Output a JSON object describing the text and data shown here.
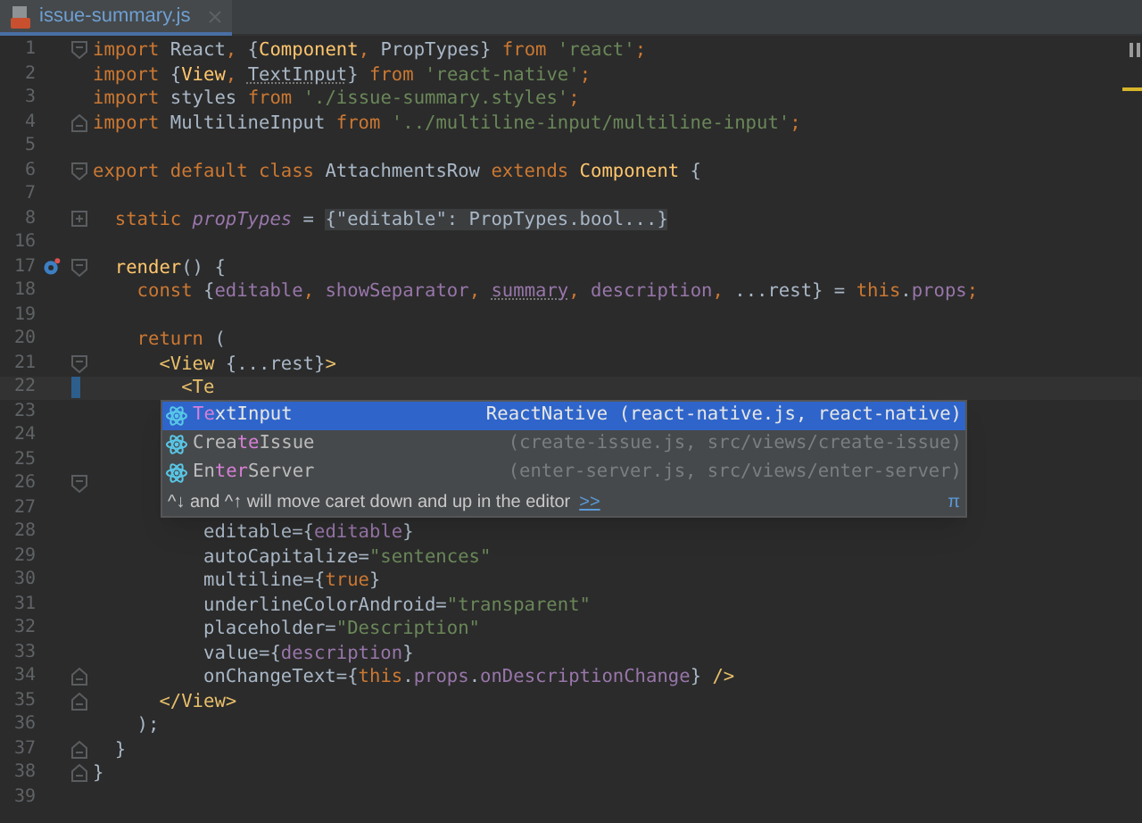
{
  "tab": {
    "title": "issue-summary.js",
    "selected": true
  },
  "lines": [
    {
      "number": "1",
      "fold": {
        "kind": "open"
      },
      "current": false,
      "tokens": [
        {
          "kind": "kw",
          "text": "import"
        },
        {
          "kind": "plain",
          "text": " React"
        },
        {
          "kind": "kw",
          "text": ","
        },
        {
          "kind": "plain",
          "text": " {"
        },
        {
          "kind": "type",
          "text": "Component"
        },
        {
          "kind": "kw",
          "text": ","
        },
        {
          "kind": "plain",
          "text": " PropTypes} "
        },
        {
          "kind": "kw",
          "text": "from"
        },
        {
          "kind": "str",
          "text": " 'react'"
        },
        {
          "kind": "kw",
          "text": ";"
        }
      ]
    },
    {
      "number": "2",
      "current": false,
      "tokens": [
        {
          "kind": "kw",
          "text": "import"
        },
        {
          "kind": "plain",
          "text": " {"
        },
        {
          "kind": "type",
          "text": "View"
        },
        {
          "kind": "kw",
          "text": ", "
        },
        {
          "kind": "unused",
          "text": "TextInput"
        },
        {
          "kind": "plain",
          "text": "} "
        },
        {
          "kind": "kw",
          "text": "from"
        },
        {
          "kind": "str",
          "text": " 'react-native'"
        },
        {
          "kind": "kw",
          "text": ";"
        }
      ]
    },
    {
      "number": "3",
      "current": false,
      "tokens": [
        {
          "kind": "kw",
          "text": "import"
        },
        {
          "kind": "plain",
          "text": " styles "
        },
        {
          "kind": "kw",
          "text": "from"
        },
        {
          "kind": "str",
          "text": " './issue-summary.styles'"
        },
        {
          "kind": "kw",
          "text": ";"
        }
      ]
    },
    {
      "number": "4",
      "fold": {
        "kind": "close"
      },
      "current": false,
      "tokens": [
        {
          "kind": "kw",
          "text": "import"
        },
        {
          "kind": "plain",
          "text": " MultilineInput "
        },
        {
          "kind": "kw",
          "text": "from"
        },
        {
          "kind": "str",
          "text": " '../multiline-input/multiline-input'"
        },
        {
          "kind": "kw",
          "text": ";"
        }
      ]
    },
    {
      "number": "5",
      "current": false
    },
    {
      "number": "6",
      "fold": {
        "kind": "open"
      },
      "current": false,
      "tokens": [
        {
          "kind": "kw",
          "text": "export default class"
        },
        {
          "kind": "plain",
          "text": " AttachmentsRow "
        },
        {
          "kind": "kw",
          "text": "extends"
        },
        {
          "kind": "type",
          "text": " Component"
        },
        {
          "kind": "plain",
          "text": " {"
        }
      ]
    },
    {
      "number": "7",
      "current": false
    },
    {
      "number": "8",
      "fold": {
        "kind": "folded"
      },
      "current": false,
      "tokens": [
        {
          "kind": "kw",
          "text": "  static"
        },
        {
          "kind": "field_italic",
          "text": " propTypes"
        },
        {
          "kind": "plain",
          "text": " = "
        },
        {
          "kind": "folded",
          "text": "{\"editable\": PropTypes.bool...}"
        }
      ]
    },
    {
      "number": "16",
      "current": false
    },
    {
      "number": "17",
      "fold": {
        "kind": "open"
      },
      "gutter_icon": {
        "kind": "override"
      },
      "current": false,
      "tokens": [
        {
          "kind": "type",
          "text": "  render"
        },
        {
          "kind": "plain",
          "text": "() {"
        }
      ]
    },
    {
      "number": "18",
      "current": false,
      "tokens": [
        {
          "kind": "kw",
          "text": "    const"
        },
        {
          "kind": "plain",
          "text": " {"
        },
        {
          "kind": "field",
          "text": "editable"
        },
        {
          "kind": "kw",
          "text": ","
        },
        {
          "kind": "field",
          "text": " showSeparator"
        },
        {
          "kind": "kw",
          "text": ", "
        },
        {
          "kind": "unused_field",
          "text": "summary"
        },
        {
          "kind": "kw",
          "text": ","
        },
        {
          "kind": "field",
          "text": " description"
        },
        {
          "kind": "kw",
          "text": ","
        },
        {
          "kind": "plain",
          "text": " ...rest} = "
        },
        {
          "kind": "kw",
          "text": "this"
        },
        {
          "kind": "plain",
          "text": "."
        },
        {
          "kind": "field",
          "text": "props"
        },
        {
          "kind": "kw",
          "text": ";"
        }
      ]
    },
    {
      "number": "19",
      "current": false
    },
    {
      "number": "20",
      "current": false,
      "tokens": [
        {
          "kind": "kw",
          "text": "    return"
        },
        {
          "kind": "plain",
          "text": " ("
        }
      ]
    },
    {
      "number": "21",
      "fold": {
        "kind": "open"
      },
      "current": false,
      "tokens": [
        {
          "kind": "tag",
          "text": "      <View"
        },
        {
          "kind": "plain",
          "text": " {...rest}"
        },
        {
          "kind": "tag",
          "text": ">"
        }
      ]
    },
    {
      "number": "22",
      "current": true,
      "tokens": [
        {
          "kind": "tag",
          "text": "        <Te"
        }
      ]
    },
    {
      "number": "23",
      "current": false
    },
    {
      "number": "24",
      "current": false
    },
    {
      "number": "25",
      "current": false
    },
    {
      "number": "26",
      "fold": {
        "kind": "open"
      },
      "current": false
    },
    {
      "number": "27",
      "current": false
    },
    {
      "number": "28",
      "current": false,
      "tokens": [
        {
          "kind": "plain",
          "text": "          editable={"
        },
        {
          "kind": "field",
          "text": "editable"
        },
        {
          "kind": "plain",
          "text": "}"
        }
      ]
    },
    {
      "number": "29",
      "current": false,
      "tokens": [
        {
          "kind": "plain",
          "text": "          autoCapitalize="
        },
        {
          "kind": "str",
          "text": "\"sentences\""
        }
      ]
    },
    {
      "number": "30",
      "current": false,
      "tokens": [
        {
          "kind": "plain",
          "text": "          multiline={"
        },
        {
          "kind": "kw",
          "text": "true"
        },
        {
          "kind": "plain",
          "text": "}"
        }
      ]
    },
    {
      "number": "31",
      "current": false,
      "tokens": [
        {
          "kind": "plain",
          "text": "          underlineColorAndroid="
        },
        {
          "kind": "str",
          "text": "\"transparent\""
        }
      ]
    },
    {
      "number": "32",
      "current": false,
      "tokens": [
        {
          "kind": "plain",
          "text": "          placeholder="
        },
        {
          "kind": "str",
          "text": "\"Description\""
        }
      ]
    },
    {
      "number": "33",
      "current": false,
      "tokens": [
        {
          "kind": "plain",
          "text": "          value={"
        },
        {
          "kind": "field",
          "text": "description"
        },
        {
          "kind": "plain",
          "text": "}"
        }
      ]
    },
    {
      "number": "34",
      "fold": {
        "kind": "close"
      },
      "current": false,
      "tokens": [
        {
          "kind": "plain",
          "text": "          onChangeText={"
        },
        {
          "kind": "kw",
          "text": "this"
        },
        {
          "kind": "plain",
          "text": "."
        },
        {
          "kind": "field",
          "text": "props"
        },
        {
          "kind": "plain",
          "text": "."
        },
        {
          "kind": "field",
          "text": "onDescriptionChange"
        },
        {
          "kind": "plain",
          "text": "} "
        },
        {
          "kind": "tag",
          "text": "/>"
        }
      ]
    },
    {
      "number": "35",
      "fold": {
        "kind": "close"
      },
      "current": false,
      "tokens": [
        {
          "kind": "tag",
          "text": "      </View>"
        }
      ]
    },
    {
      "number": "36",
      "current": false,
      "tokens": [
        {
          "kind": "plain",
          "text": "    );"
        }
      ]
    },
    {
      "number": "37",
      "fold": {
        "kind": "close"
      },
      "current": false,
      "tokens": [
        {
          "kind": "plain",
          "text": "  }"
        }
      ]
    },
    {
      "number": "38",
      "fold": {
        "kind": "close"
      },
      "current": false,
      "tokens": [
        {
          "kind": "plain",
          "text": "}"
        }
      ]
    },
    {
      "number": "39",
      "current": false
    }
  ],
  "completion": {
    "items": [
      {
        "parts": [
          {
            "text": "Te",
            "match": true
          },
          {
            "text": "xtInput",
            "match": false
          }
        ],
        "detail": "ReactNative (react-native.js, react-native)",
        "selected": true
      },
      {
        "parts": [
          {
            "text": "Crea",
            "match": false
          },
          {
            "text": "te",
            "match": true
          },
          {
            "text": "Issue",
            "match": false
          }
        ],
        "detail": "(create-issue.js, src/views/create-issue)",
        "selected": false
      },
      {
        "parts": [
          {
            "text": "En",
            "match": false
          },
          {
            "text": "ter",
            "match": true
          },
          {
            "text": "Server",
            "match": false
          }
        ],
        "detail": "(enter-server.js, src/views/enter-server)",
        "selected": false
      }
    ],
    "hint": "^↓ and ^↑ will move caret down and up in the editor",
    "hint_link": ">>",
    "corner_symbol": "π"
  }
}
